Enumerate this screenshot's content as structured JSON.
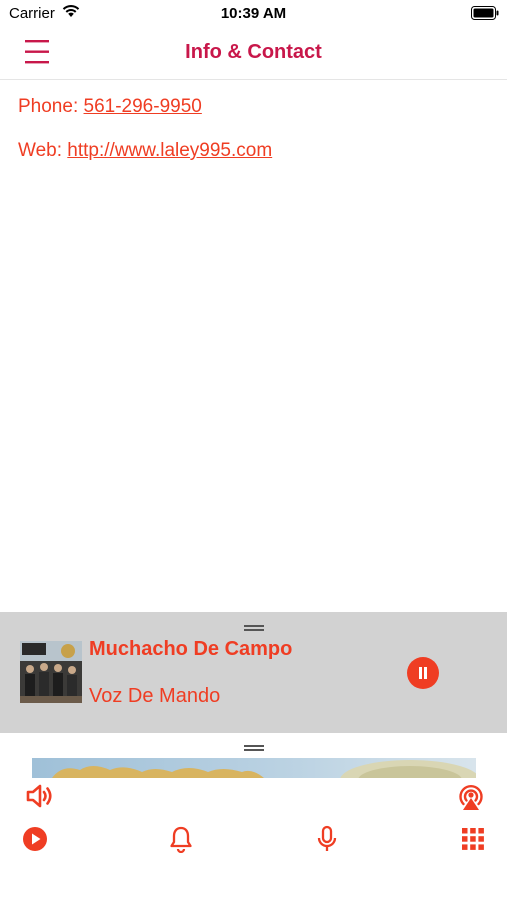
{
  "status_bar": {
    "carrier": "Carrier",
    "time": "10:39 AM"
  },
  "nav": {
    "title": "Info & Contact",
    "menu_icon": "hamburger-menu-icon"
  },
  "contact": {
    "phone_label": "Phone:",
    "phone_value": "561-296-9950",
    "web_label": "Web:",
    "web_value": "http://www.laley995.com"
  },
  "player": {
    "track_title": "Muchacho De Campo",
    "track_artist": "Voz De Mando",
    "state": "playing"
  },
  "toolbar": {
    "icons": [
      "volume-icon",
      "airplay-icon",
      "play-icon",
      "bell-icon",
      "microphone-icon",
      "grid-menu-icon"
    ]
  },
  "colors": {
    "accent": "#ef3d23",
    "title": "#c8174a",
    "player_bg": "#d2d2d2"
  }
}
